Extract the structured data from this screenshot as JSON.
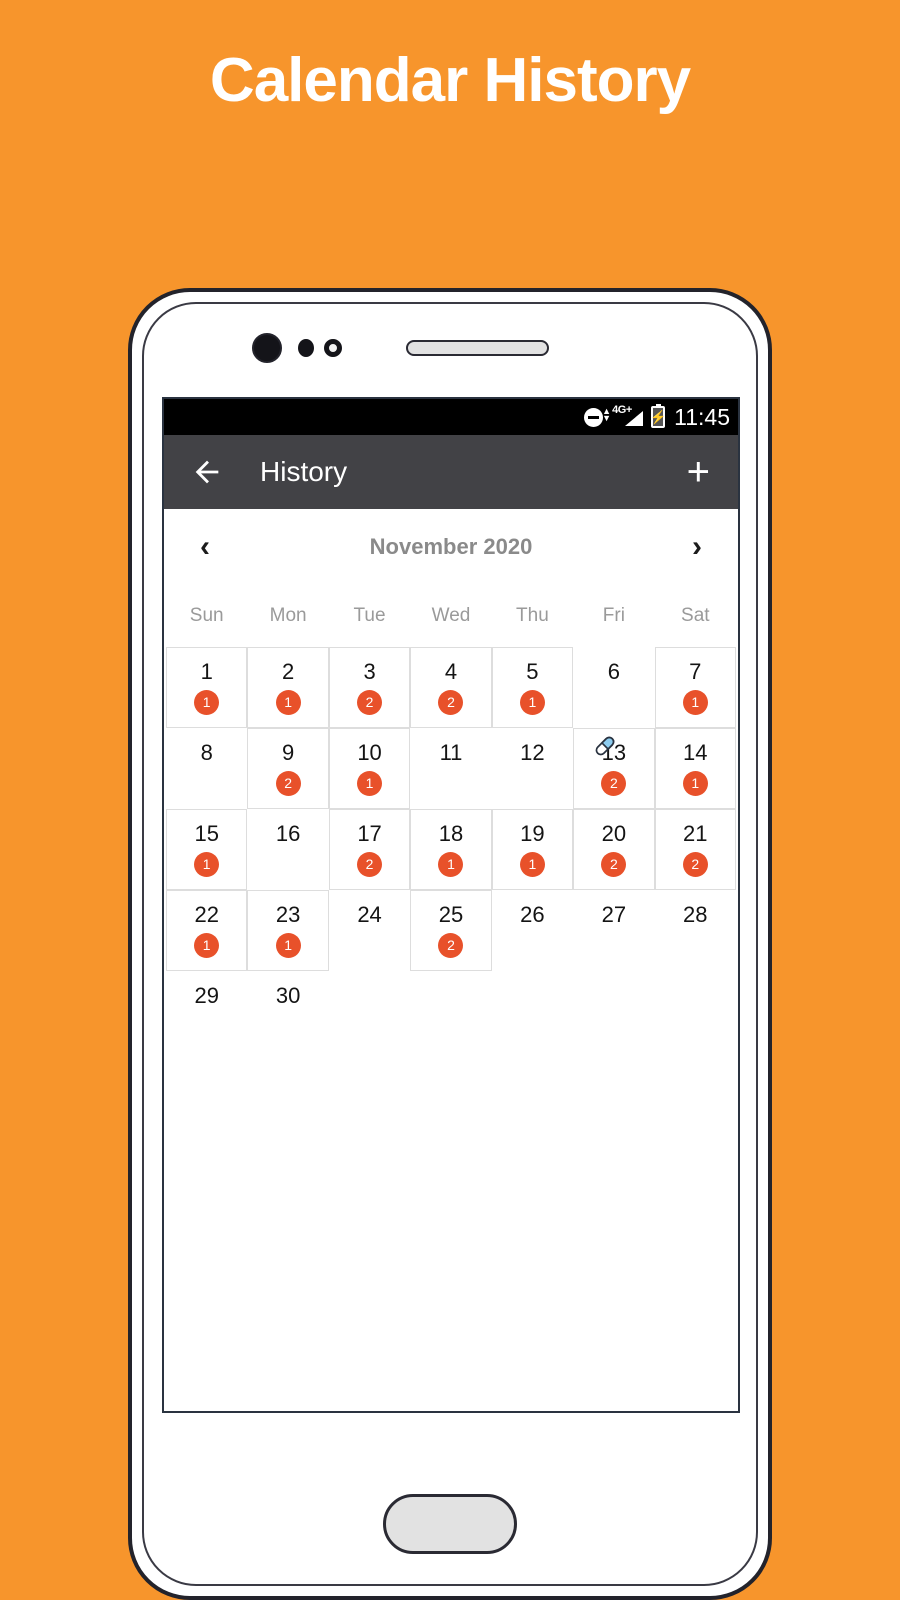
{
  "headline": "Calendar History",
  "colors": {
    "background_orange": "#f7952c",
    "app_bar": "#424246",
    "badge": "#e8512a",
    "month_label": "#8a8a8a",
    "weekday_label": "#9a9a9a",
    "cell_border": "#dddddd",
    "pill_blue": "#8ecdf0"
  },
  "status_bar": {
    "dnd_icon": "do-not-disturb-icon",
    "network_label": "4G+",
    "signal_icon": "signal-bars-icon",
    "battery_icon": "battery-charging-icon",
    "time": "11:45"
  },
  "app_bar": {
    "back_icon": "back-arrow-icon",
    "title": "History",
    "add_label": "+"
  },
  "calendar": {
    "prev_label": "‹",
    "month_label": "November 2020",
    "next_label": "›",
    "weekdays": [
      "Sun",
      "Mon",
      "Tue",
      "Wed",
      "Thu",
      "Fri",
      "Sat"
    ],
    "leading_blanks": 0,
    "days": [
      {
        "day": "1",
        "count": "1",
        "pill": false
      },
      {
        "day": "2",
        "count": "1",
        "pill": false
      },
      {
        "day": "3",
        "count": "2",
        "pill": false
      },
      {
        "day": "4",
        "count": "2",
        "pill": false
      },
      {
        "day": "5",
        "count": "1",
        "pill": false
      },
      {
        "day": "6",
        "count": "",
        "pill": false
      },
      {
        "day": "7",
        "count": "1",
        "pill": false
      },
      {
        "day": "8",
        "count": "",
        "pill": false
      },
      {
        "day": "9",
        "count": "2",
        "pill": false
      },
      {
        "day": "10",
        "count": "1",
        "pill": false
      },
      {
        "day": "11",
        "count": "",
        "pill": false
      },
      {
        "day": "12",
        "count": "",
        "pill": false
      },
      {
        "day": "13",
        "count": "2",
        "pill": true
      },
      {
        "day": "14",
        "count": "1",
        "pill": false
      },
      {
        "day": "15",
        "count": "1",
        "pill": false
      },
      {
        "day": "16",
        "count": "",
        "pill": false
      },
      {
        "day": "17",
        "count": "2",
        "pill": false
      },
      {
        "day": "18",
        "count": "1",
        "pill": false
      },
      {
        "day": "19",
        "count": "1",
        "pill": false
      },
      {
        "day": "20",
        "count": "2",
        "pill": false
      },
      {
        "day": "21",
        "count": "2",
        "pill": false
      },
      {
        "day": "22",
        "count": "1",
        "pill": false
      },
      {
        "day": "23",
        "count": "1",
        "pill": false
      },
      {
        "day": "24",
        "count": "",
        "pill": false
      },
      {
        "day": "25",
        "count": "2",
        "pill": false
      },
      {
        "day": "26",
        "count": "",
        "pill": false
      },
      {
        "day": "27",
        "count": "",
        "pill": false
      },
      {
        "day": "28",
        "count": "",
        "pill": false
      },
      {
        "day": "29",
        "count": "",
        "pill": false
      },
      {
        "day": "30",
        "count": "",
        "pill": false
      }
    ]
  },
  "device": {
    "camera_icon": "camera-lens-icon",
    "sensor_icon": "proximity-sensor-icon",
    "speaker_icon": "earpiece-speaker-icon",
    "home_button": "home-button"
  }
}
